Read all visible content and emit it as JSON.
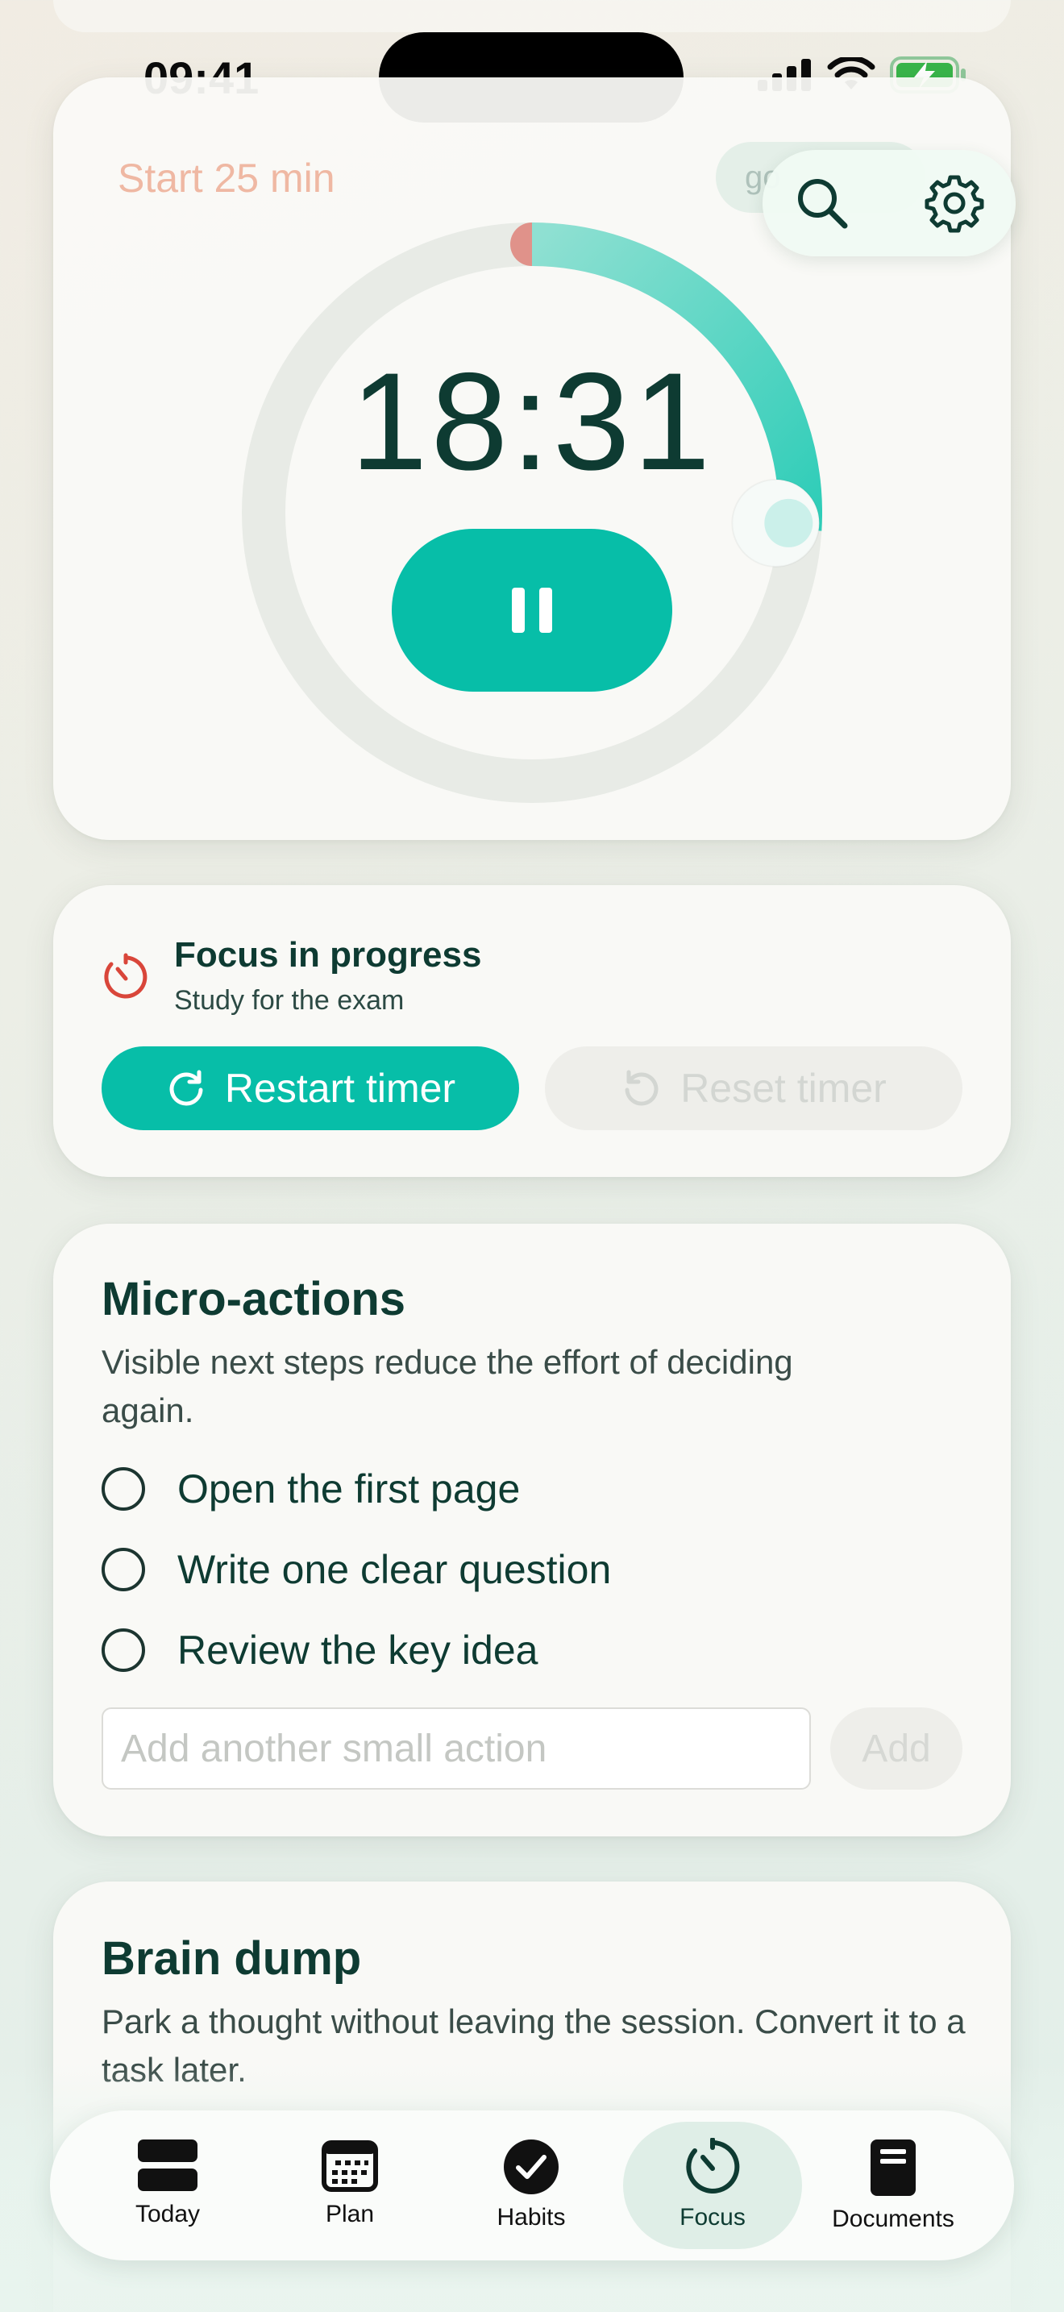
{
  "status_bar": {
    "time": "09:41"
  },
  "timer": {
    "start_label": "Start 25 min",
    "faded_pill_label": "go",
    "remaining": "18:31",
    "progress_fraction": 0.26
  },
  "top_actions": {
    "search_icon": "search-icon",
    "settings_icon": "gear-icon"
  },
  "progress": {
    "title": "Focus in progress",
    "subtitle": "Study for the exam",
    "restart_label": "Restart timer",
    "reset_label": "Reset timer"
  },
  "micro": {
    "title": "Micro-actions",
    "description": "Visible next steps reduce the effort of deciding again.",
    "items": [
      {
        "label": "Open the first page"
      },
      {
        "label": "Write one clear question"
      },
      {
        "label": "Review the key idea"
      }
    ],
    "input_placeholder": "Add another small action",
    "add_label": "Add"
  },
  "brain": {
    "title": "Brain dump",
    "description": "Park a thought without leaving the session. Convert it to a task later."
  },
  "tabs": [
    {
      "label": "Today"
    },
    {
      "label": "Plan"
    },
    {
      "label": "Habits"
    },
    {
      "label": "Focus"
    },
    {
      "label": "Documents"
    }
  ],
  "colors": {
    "accent": "#07bea8",
    "ink": "#0e3b32",
    "ring_track": "#e8ebe6",
    "ring_start": "#e0928a"
  }
}
